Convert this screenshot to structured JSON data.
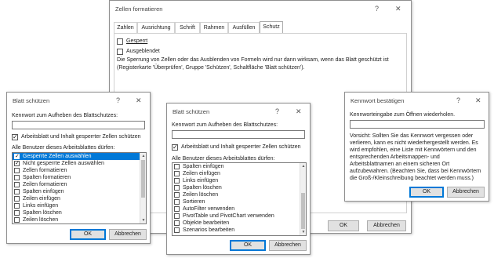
{
  "zellen_formatieren": {
    "title": "Zellen formatieren",
    "help": "?",
    "close": "✕",
    "tabs": [
      "Zahlen",
      "Ausrichtung",
      "Schrift",
      "Rahmen",
      "Ausfüllen",
      "Schutz"
    ],
    "active_tab": "Schutz",
    "gesperrt_label": "Gesperrt",
    "gesperrt_checked": false,
    "ausgeblendet_label": "Ausgeblendet",
    "ausgeblendet_checked": false,
    "info_line1": "Die Sperrung von Zellen oder das Ausblenden von Formeln wird nur dann wirksam, wenn das Blatt geschützt ist",
    "info_line2": "(Registerkarte 'Überprüfen', Gruppe 'Schützen', Schaltfläche 'Blatt schützen')."
  },
  "blatt_schuetzen_1": {
    "title": "Blatt schützen",
    "help": "?",
    "close": "✕",
    "password_label": "Kennwort zum Aufheben des Blattschutzes:",
    "password_value": "",
    "protect_label": "Arbeitsblatt und Inhalt gesperrter Zellen schützen",
    "protect_checked": true,
    "allow_label": "Alle Benutzer dieses Arbeitsblattes dürfen:",
    "items": [
      {
        "label": "Gesperrte Zellen auswählen",
        "checked": true,
        "selected": true
      },
      {
        "label": "Nicht gesperrte Zellen auswählen",
        "checked": true,
        "selected": false
      },
      {
        "label": "Zellen formatieren",
        "checked": false,
        "selected": false
      },
      {
        "label": "Spalten formatieren",
        "checked": false,
        "selected": false
      },
      {
        "label": "Zeilen formatieren",
        "checked": false,
        "selected": false
      },
      {
        "label": "Spalten einfügen",
        "checked": false,
        "selected": false
      },
      {
        "label": "Zeilen einfügen",
        "checked": false,
        "selected": false
      },
      {
        "label": "Links einfügen",
        "checked": false,
        "selected": false
      },
      {
        "label": "Spalten löschen",
        "checked": false,
        "selected": false
      },
      {
        "label": "Zeilen löschen",
        "checked": false,
        "selected": false
      }
    ],
    "ok_label": "OK",
    "cancel_label": "Abbrechen"
  },
  "blatt_schuetzen_2": {
    "title": "Blatt schützen",
    "help": "?",
    "close": "✕",
    "password_label": "Kennwort zum Aufheben des Blattschutzes:",
    "password_value": "",
    "protect_label": "Arbeitsblatt und Inhalt gesperrter Zellen schützen",
    "protect_checked": true,
    "allow_label": "Alle Benutzer dieses Arbeitsblattes dürfen:",
    "items": [
      {
        "label": "Spalten einfügen",
        "checked": false
      },
      {
        "label": "Zeilen einfügen",
        "checked": false
      },
      {
        "label": "Links einfügen",
        "checked": false
      },
      {
        "label": "Spalten löschen",
        "checked": false
      },
      {
        "label": "Zeilen löschen",
        "checked": false
      },
      {
        "label": "Sortieren",
        "checked": false
      },
      {
        "label": "AutoFilter verwenden",
        "checked": false
      },
      {
        "label": "PivotTable und PivotChart verwenden",
        "checked": false
      },
      {
        "label": "Objekte bearbeiten",
        "checked": false
      },
      {
        "label": "Szenarios bearbeiten",
        "checked": false
      }
    ],
    "ok_label": "OK",
    "cancel_label": "Abbrechen"
  },
  "zf_buttons": {
    "ok_label": "OK",
    "cancel_label": "Abbrechen"
  },
  "kennwort_bestaetigen": {
    "title": "Kennwort bestätigen",
    "help": "?",
    "close": "✕",
    "reenter_label": "Kennworteingabe zum Öffnen wiederholen.",
    "reenter_value": "",
    "warning_lines": [
      "Vorsicht: Sollten Sie das Kennwort vergessen oder",
      "verlieren, kann es nicht wiederhergestellt werden. Es",
      "wird empfohlen, eine Liste mit Kennwörtern und den",
      "entsprechenden Arbeitsmappen- und",
      "Arbeitsblattnamen an einem sicheren Ort",
      "aufzubewahren. (Beachten Sie, dass bei Kennwörtern",
      "die Groß-/Kleinschreibung beachtet werden muss.)"
    ],
    "ok_label": "OK",
    "cancel_label": "Abbrechen"
  }
}
